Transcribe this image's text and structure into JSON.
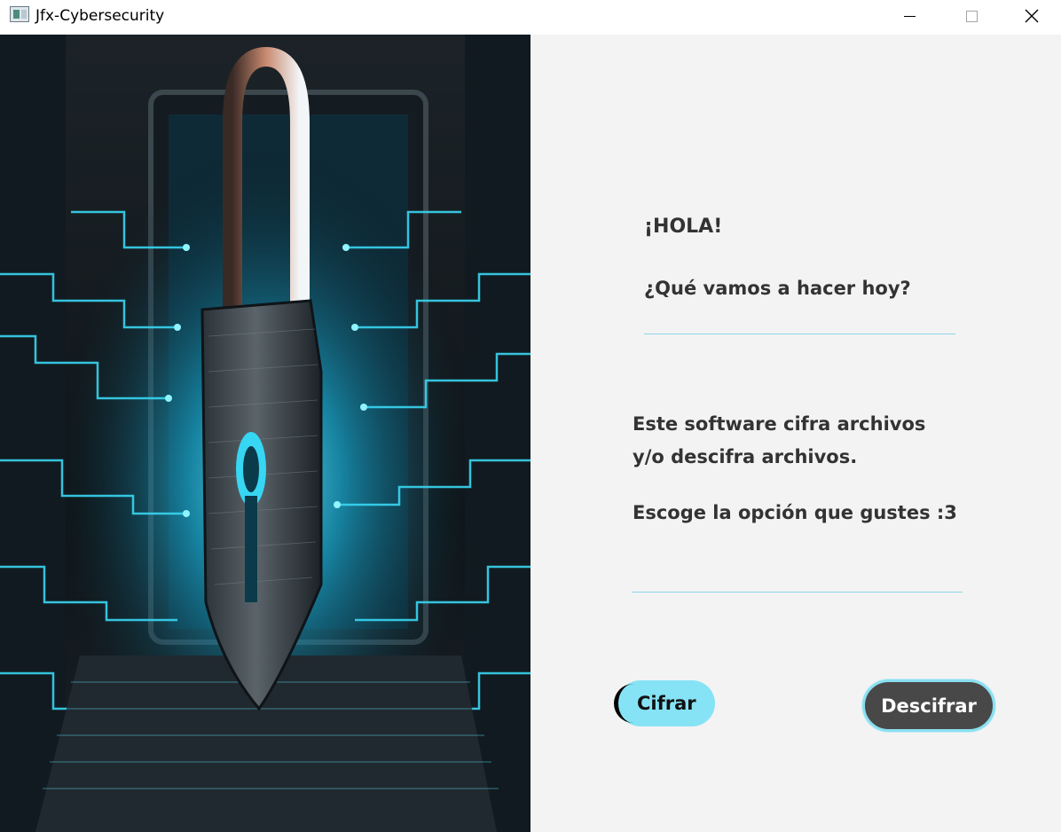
{
  "window": {
    "title": "Jfx-Cybersecurity",
    "icon": "app-window-icon",
    "controls": {
      "minimize_icon": "minimize-icon",
      "maximize_icon": "maximize-icon",
      "close_icon": "close-icon"
    }
  },
  "hero_image": {
    "subject": "glowing padlock over laptop with circuit lines",
    "colors": {
      "glow": "#27d2f0",
      "dark": "#0a0f14"
    }
  },
  "panel": {
    "greeting": "¡HOLA!",
    "question": "¿Qué vamos a hacer hoy?",
    "description_line1": "Este software cifra archivos",
    "description_line2": "y/o descifra archivos.",
    "prompt": "Escoge la opción que gustes :3",
    "colors": {
      "background": "#f3f3f3",
      "separator": "#8ad8e8",
      "text": "#333333"
    }
  },
  "actions": {
    "encrypt_label": "Cifrar",
    "decrypt_label": "Descifrar",
    "colors": {
      "encrypt_bg": "#86e3f5",
      "decrypt_bg": "#484848",
      "decrypt_border": "#89dff0"
    }
  }
}
